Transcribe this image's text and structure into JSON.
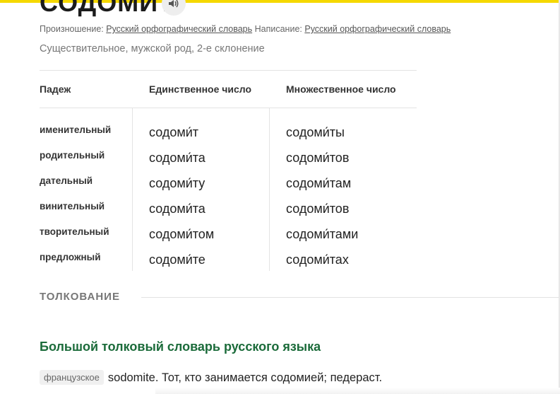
{
  "headword": "СОДОМИТ",
  "meta": {
    "pronunciation_label": "Произношение:",
    "pronunciation_link": "Русский орфографический словарь",
    "spelling_label": "Написание:",
    "spelling_link": "Русский орфографический словарь"
  },
  "part_of_speech": "Существительное, мужской род, 2-е склонение",
  "table": {
    "headers": [
      "Падеж",
      "Единственное число",
      "Множественное число"
    ],
    "rows": [
      {
        "case": "именительный",
        "singular": "содоми́т",
        "plural": "содоми́ты"
      },
      {
        "case": "родительный",
        "singular": "содоми́та",
        "plural": "содоми́тов"
      },
      {
        "case": "дательный",
        "singular": "содоми́ту",
        "plural": "содоми́там"
      },
      {
        "case": "винительный",
        "singular": "содоми́та",
        "plural": "содоми́тов"
      },
      {
        "case": "творительный",
        "singular": "содоми́том",
        "plural": "содоми́тами"
      },
      {
        "case": "предложный",
        "singular": "содоми́те",
        "plural": "содоми́тах"
      }
    ]
  },
  "interpretation": {
    "section_title": "ТОЛКОВАНИЕ",
    "dictionary_title": "Большой толковый словарь русского языка",
    "language_tag": "французское",
    "definition": "sodomite. Тот, кто занимается содомией; педераст."
  },
  "colors": {
    "accent_yellow": "#f5d800",
    "dictionary_green": "#1b6b3a"
  },
  "icons": {
    "speaker": "speaker-icon"
  }
}
